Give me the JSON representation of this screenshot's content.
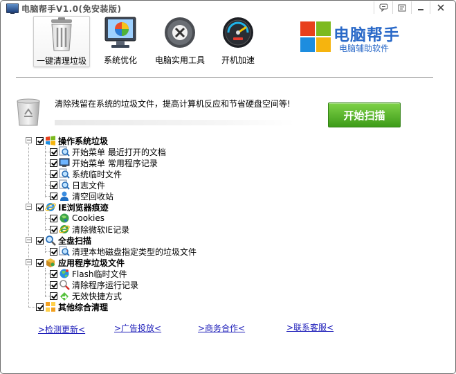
{
  "window": {
    "title": "电脑帮手V1.0(免安装版)"
  },
  "titlebar_buttons": [
    {
      "name": "feedback",
      "icon": "speech-bubble-icon"
    },
    {
      "name": "skin",
      "icon": "skin-icon"
    },
    {
      "name": "minimize",
      "icon": "minimize-icon"
    },
    {
      "name": "close",
      "icon": "close-icon"
    }
  ],
  "toolbar": {
    "items": [
      {
        "label": "一键清理垃圾",
        "icon": "trash-can-icon",
        "active": true
      },
      {
        "label": "系统优化",
        "icon": "monitor-icon",
        "active": false
      },
      {
        "label": "电脑实用工具",
        "icon": "tools-icon",
        "active": false
      },
      {
        "label": "开机加速",
        "icon": "speedometer-icon",
        "active": false
      }
    ]
  },
  "logo": {
    "name": "电脑帮手",
    "subtitle": "电脑辅助软件",
    "colors": [
      "#e8401c",
      "#7dba1f",
      "#1d8ddf",
      "#f6b40e"
    ]
  },
  "description": {
    "text": "清除残留在系统的垃圾文件，提高计算机反应和节省硬盘空间等!",
    "icon": "recycle-bin-icon"
  },
  "scan_button": {
    "label": "开始扫描",
    "color": "#4fae28"
  },
  "tree": {
    "groups": [
      {
        "label": "操作系统垃圾",
        "icon": "windows-flag-icon",
        "checked": true,
        "expanded": true,
        "children": [
          {
            "label": "开始菜单 最近打开的文档",
            "icon": "magnifier-icon",
            "checked": true
          },
          {
            "label": "开始菜单 常用程序记录",
            "icon": "monitor-small-icon",
            "checked": true
          },
          {
            "label": "系统临时文件",
            "icon": "magnifier-icon",
            "checked": true
          },
          {
            "label": "日志文件",
            "icon": "magnifier-icon",
            "checked": true
          },
          {
            "label": "清空回收站",
            "icon": "user-icon",
            "checked": true
          }
        ]
      },
      {
        "label": "IE浏览器痕迹",
        "icon": "ie-icon",
        "checked": true,
        "expanded": true,
        "children": [
          {
            "label": "Cookies",
            "icon": "cookie-globe-icon",
            "checked": true
          },
          {
            "label": "清除微软IE记录",
            "icon": "ie-icon",
            "checked": true
          }
        ]
      },
      {
        "label": "全盘扫描",
        "icon": "magnifier-icon",
        "checked": true,
        "expanded": true,
        "children": [
          {
            "label": "清理本地磁盘指定类型的垃圾文件",
            "icon": "magnifier-icon",
            "checked": true
          }
        ]
      },
      {
        "label": "应用程序垃圾文件",
        "icon": "app-box-icon",
        "checked": true,
        "expanded": true,
        "children": [
          {
            "label": "Flash临时文件",
            "icon": "globe-icon",
            "checked": true
          },
          {
            "label": "清除程序运行记录",
            "icon": "search-red-icon",
            "checked": true
          },
          {
            "label": "无效快捷方式",
            "icon": "shortcut-icon",
            "checked": true
          }
        ]
      },
      {
        "label": "其他综合清理",
        "icon": "grid-icon",
        "checked": true,
        "expanded": false,
        "children": []
      }
    ]
  },
  "links": [
    {
      "label": ">检测更新<"
    },
    {
      "label": ">广告投放<"
    },
    {
      "label": ">商务合作<"
    },
    {
      "label": ">联系客服<"
    }
  ]
}
